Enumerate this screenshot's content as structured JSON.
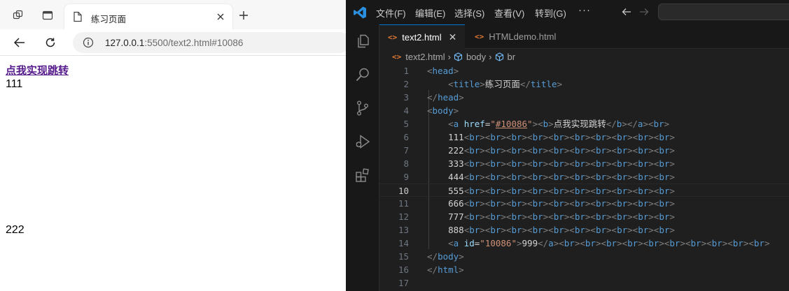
{
  "browser": {
    "tab_title": "练习页面",
    "url_host": "127.0.0.1",
    "url_rest": ":5500/text2.html#10086",
    "page": {
      "link_text": "点我实现跳转",
      "line1": "111",
      "line2": "222"
    }
  },
  "vscode": {
    "menus": [
      "文件(F)",
      "编辑(E)",
      "选择(S)",
      "查看(V)",
      "转到(G)"
    ],
    "more": "···",
    "tabs": [
      {
        "label": "text2.html",
        "active": true
      },
      {
        "label": "HTMLdemo.html",
        "active": false
      }
    ],
    "breadcrumb": [
      "text2.html",
      "body",
      "br"
    ],
    "current_line": 10,
    "code_lines": [
      {
        "n": "1",
        "tokens": [
          [
            "t",
            "<"
          ],
          [
            "n",
            "head"
          ],
          [
            "t",
            ">"
          ]
        ]
      },
      {
        "n": "2",
        "tokens": [
          [
            "w",
            "    "
          ],
          [
            "t",
            "<"
          ],
          [
            "n",
            "title"
          ],
          [
            "t",
            ">"
          ],
          [
            "w",
            "练习页面"
          ],
          [
            "t",
            "</"
          ],
          [
            "n",
            "title"
          ],
          [
            "t",
            ">"
          ]
        ]
      },
      {
        "n": "3",
        "tokens": [
          [
            "t",
            "</"
          ],
          [
            "n",
            "head"
          ],
          [
            "t",
            ">"
          ]
        ]
      },
      {
        "n": "4",
        "tokens": [
          [
            "t",
            "<"
          ],
          [
            "n",
            "body"
          ],
          [
            "t",
            ">"
          ]
        ]
      },
      {
        "n": "5",
        "tokens": [
          [
            "w",
            "    "
          ],
          [
            "t",
            "<"
          ],
          [
            "n",
            "a"
          ],
          [
            "w",
            " "
          ],
          [
            "a",
            "href"
          ],
          [
            "w",
            "="
          ],
          [
            "s",
            "\""
          ],
          [
            "su",
            "#10086"
          ],
          [
            "s",
            "\""
          ],
          [
            "t",
            "><"
          ],
          [
            "n",
            "b"
          ],
          [
            "t",
            ">"
          ],
          [
            "w",
            "点我实现跳转"
          ],
          [
            "t",
            "</"
          ],
          [
            "n",
            "b"
          ],
          [
            "t",
            "></"
          ],
          [
            "n",
            "a"
          ],
          [
            "t",
            "><"
          ],
          [
            "n",
            "br"
          ],
          [
            "t",
            ">"
          ]
        ]
      },
      {
        "n": "6",
        "tokens": [
          [
            "w",
            "    111"
          ],
          [
            "t",
            "<"
          ],
          [
            "n",
            "br"
          ],
          [
            "t",
            "><"
          ],
          [
            "n",
            "br"
          ],
          [
            "t",
            "><"
          ],
          [
            "n",
            "br"
          ],
          [
            "t",
            "><"
          ],
          [
            "n",
            "br"
          ],
          [
            "t",
            "><"
          ],
          [
            "n",
            "br"
          ],
          [
            "t",
            "><"
          ],
          [
            "n",
            "br"
          ],
          [
            "t",
            "><"
          ],
          [
            "n",
            "br"
          ],
          [
            "t",
            "><"
          ],
          [
            "n",
            "br"
          ],
          [
            "t",
            "><"
          ],
          [
            "n",
            "br"
          ],
          [
            "t",
            "><"
          ],
          [
            "n",
            "br"
          ],
          [
            "t",
            ">"
          ]
        ]
      },
      {
        "n": "7",
        "tokens": [
          [
            "w",
            "    222"
          ],
          [
            "t",
            "<"
          ],
          [
            "n",
            "br"
          ],
          [
            "t",
            "><"
          ],
          [
            "n",
            "br"
          ],
          [
            "t",
            "><"
          ],
          [
            "n",
            "br"
          ],
          [
            "t",
            "><"
          ],
          [
            "n",
            "br"
          ],
          [
            "t",
            "><"
          ],
          [
            "n",
            "br"
          ],
          [
            "t",
            "><"
          ],
          [
            "n",
            "br"
          ],
          [
            "t",
            "><"
          ],
          [
            "n",
            "br"
          ],
          [
            "t",
            "><"
          ],
          [
            "n",
            "br"
          ],
          [
            "t",
            "><"
          ],
          [
            "n",
            "br"
          ],
          [
            "t",
            "><"
          ],
          [
            "n",
            "br"
          ],
          [
            "t",
            ">"
          ]
        ]
      },
      {
        "n": "8",
        "tokens": [
          [
            "w",
            "    333"
          ],
          [
            "t",
            "<"
          ],
          [
            "n",
            "br"
          ],
          [
            "t",
            "><"
          ],
          [
            "n",
            "br"
          ],
          [
            "t",
            "><"
          ],
          [
            "n",
            "br"
          ],
          [
            "t",
            "><"
          ],
          [
            "n",
            "br"
          ],
          [
            "t",
            "><"
          ],
          [
            "n",
            "br"
          ],
          [
            "t",
            "><"
          ],
          [
            "n",
            "br"
          ],
          [
            "t",
            "><"
          ],
          [
            "n",
            "br"
          ],
          [
            "t",
            "><"
          ],
          [
            "n",
            "br"
          ],
          [
            "t",
            "><"
          ],
          [
            "n",
            "br"
          ],
          [
            "t",
            "><"
          ],
          [
            "n",
            "br"
          ],
          [
            "t",
            ">"
          ]
        ]
      },
      {
        "n": "9",
        "tokens": [
          [
            "w",
            "    444"
          ],
          [
            "t",
            "<"
          ],
          [
            "n",
            "br"
          ],
          [
            "t",
            "><"
          ],
          [
            "n",
            "br"
          ],
          [
            "t",
            "><"
          ],
          [
            "n",
            "br"
          ],
          [
            "t",
            "><"
          ],
          [
            "n",
            "br"
          ],
          [
            "t",
            "><"
          ],
          [
            "n",
            "br"
          ],
          [
            "t",
            "><"
          ],
          [
            "n",
            "br"
          ],
          [
            "t",
            "><"
          ],
          [
            "n",
            "br"
          ],
          [
            "t",
            "><"
          ],
          [
            "n",
            "br"
          ],
          [
            "t",
            "><"
          ],
          [
            "n",
            "br"
          ],
          [
            "t",
            "><"
          ],
          [
            "n",
            "br"
          ],
          [
            "t",
            ">"
          ]
        ]
      },
      {
        "n": "10",
        "tokens": [
          [
            "w",
            "    555"
          ],
          [
            "t",
            "<"
          ],
          [
            "n",
            "br"
          ],
          [
            "t",
            "><"
          ],
          [
            "n",
            "br"
          ],
          [
            "t",
            "><"
          ],
          [
            "n",
            "br"
          ],
          [
            "t",
            "><"
          ],
          [
            "n",
            "br"
          ],
          [
            "t",
            "><"
          ],
          [
            "n",
            "br"
          ],
          [
            "t",
            "><"
          ],
          [
            "n",
            "br"
          ],
          [
            "t",
            "><"
          ],
          [
            "n",
            "br"
          ],
          [
            "t",
            "><"
          ],
          [
            "n",
            "br"
          ],
          [
            "t",
            "><"
          ],
          [
            "n",
            "br"
          ],
          [
            "t",
            "><"
          ],
          [
            "n",
            "br"
          ],
          [
            "t",
            ">"
          ]
        ]
      },
      {
        "n": "11",
        "tokens": [
          [
            "w",
            "    666"
          ],
          [
            "t",
            "<"
          ],
          [
            "n",
            "br"
          ],
          [
            "t",
            "><"
          ],
          [
            "n",
            "br"
          ],
          [
            "t",
            "><"
          ],
          [
            "n",
            "br"
          ],
          [
            "t",
            "><"
          ],
          [
            "n",
            "br"
          ],
          [
            "t",
            "><"
          ],
          [
            "n",
            "br"
          ],
          [
            "t",
            "><"
          ],
          [
            "n",
            "br"
          ],
          [
            "t",
            "><"
          ],
          [
            "n",
            "br"
          ],
          [
            "t",
            "><"
          ],
          [
            "n",
            "br"
          ],
          [
            "t",
            "><"
          ],
          [
            "n",
            "br"
          ],
          [
            "t",
            "><"
          ],
          [
            "n",
            "br"
          ],
          [
            "t",
            ">"
          ]
        ]
      },
      {
        "n": "12",
        "tokens": [
          [
            "w",
            "    777"
          ],
          [
            "t",
            "<"
          ],
          [
            "n",
            "br"
          ],
          [
            "t",
            "><"
          ],
          [
            "n",
            "br"
          ],
          [
            "t",
            "><"
          ],
          [
            "n",
            "br"
          ],
          [
            "t",
            "><"
          ],
          [
            "n",
            "br"
          ],
          [
            "t",
            "><"
          ],
          [
            "n",
            "br"
          ],
          [
            "t",
            "><"
          ],
          [
            "n",
            "br"
          ],
          [
            "t",
            "><"
          ],
          [
            "n",
            "br"
          ],
          [
            "t",
            "><"
          ],
          [
            "n",
            "br"
          ],
          [
            "t",
            "><"
          ],
          [
            "n",
            "br"
          ],
          [
            "t",
            "><"
          ],
          [
            "n",
            "br"
          ],
          [
            "t",
            ">"
          ]
        ]
      },
      {
        "n": "13",
        "tokens": [
          [
            "w",
            "    888"
          ],
          [
            "t",
            "<"
          ],
          [
            "n",
            "br"
          ],
          [
            "t",
            "><"
          ],
          [
            "n",
            "br"
          ],
          [
            "t",
            "><"
          ],
          [
            "n",
            "br"
          ],
          [
            "t",
            "><"
          ],
          [
            "n",
            "br"
          ],
          [
            "t",
            "><"
          ],
          [
            "n",
            "br"
          ],
          [
            "t",
            "><"
          ],
          [
            "n",
            "br"
          ],
          [
            "t",
            "><"
          ],
          [
            "n",
            "br"
          ],
          [
            "t",
            "><"
          ],
          [
            "n",
            "br"
          ],
          [
            "t",
            "><"
          ],
          [
            "n",
            "br"
          ],
          [
            "t",
            "><"
          ],
          [
            "n",
            "br"
          ],
          [
            "t",
            ">"
          ]
        ]
      },
      {
        "n": "14",
        "tokens": [
          [
            "w",
            "    "
          ],
          [
            "t",
            "<"
          ],
          [
            "n",
            "a"
          ],
          [
            "w",
            " "
          ],
          [
            "a",
            "id"
          ],
          [
            "w",
            "="
          ],
          [
            "s",
            "\"10086\""
          ],
          [
            "t",
            ">"
          ],
          [
            "w",
            "999"
          ],
          [
            "t",
            "</"
          ],
          [
            "n",
            "a"
          ],
          [
            "t",
            "><"
          ],
          [
            "n",
            "br"
          ],
          [
            "t",
            "><"
          ],
          [
            "n",
            "br"
          ],
          [
            "t",
            "><"
          ],
          [
            "n",
            "br"
          ],
          [
            "t",
            "><"
          ],
          [
            "n",
            "br"
          ],
          [
            "t",
            "><"
          ],
          [
            "n",
            "br"
          ],
          [
            "t",
            "><"
          ],
          [
            "n",
            "br"
          ],
          [
            "t",
            "><"
          ],
          [
            "n",
            "br"
          ],
          [
            "t",
            "><"
          ],
          [
            "n",
            "br"
          ],
          [
            "t",
            "><"
          ],
          [
            "n",
            "br"
          ],
          [
            "t",
            "><"
          ],
          [
            "n",
            "br"
          ],
          [
            "t",
            ">"
          ]
        ]
      },
      {
        "n": "15",
        "tokens": [
          [
            "t",
            "</"
          ],
          [
            "n",
            "body"
          ],
          [
            "t",
            ">"
          ]
        ]
      },
      {
        "n": "16",
        "tokens": [
          [
            "t",
            "</"
          ],
          [
            "n",
            "html"
          ],
          [
            "t",
            ">"
          ]
        ]
      },
      {
        "n": "17",
        "tokens": []
      }
    ]
  }
}
